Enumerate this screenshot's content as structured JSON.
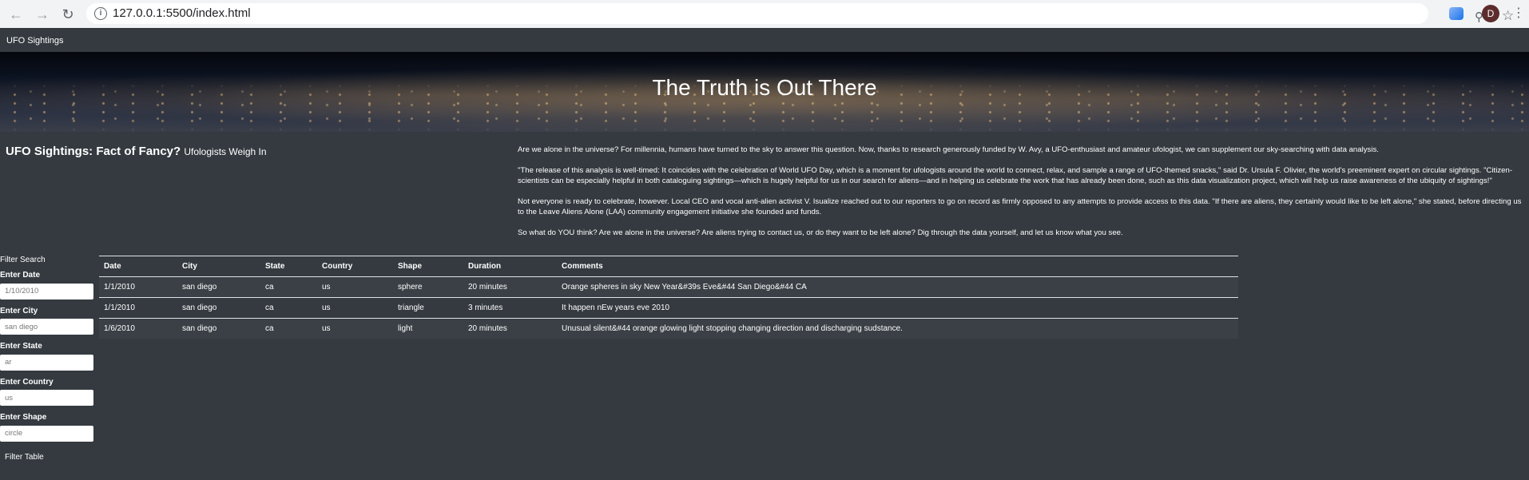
{
  "browser": {
    "url": "127.0.0.1:5500/index.html",
    "avatar_letter": "D",
    "icons": [
      "back-arrow-icon",
      "forward-arrow-icon",
      "reload-icon",
      "info-icon",
      "zoom-icon",
      "star-icon",
      "extension-icon",
      "menu-icon"
    ]
  },
  "navbar": {
    "brand": "UFO Sightings"
  },
  "hero": {
    "title": "The Truth is Out There"
  },
  "intro": {
    "title": "UFO Sightings: Fact of Fancy?",
    "subtitle": "Ufologists Weigh In",
    "paragraphs": [
      "Are we alone in the universe? For millennia, humans have turned to the sky to answer this question. Now, thanks to research generously funded by W. Avy, a UFO-enthusiast and amateur ufologist, we can supplement our sky-searching with data analysis.",
      "\"The release of this analysis is well-timed: It coincides with the celebration of World UFO Day, which is a moment for ufologists around the world to connect, relax, and sample a range of UFO-themed snacks,\" said Dr. Ursula F. Olivier, the world's preeminent expert on circular sightings. \"Citizen-scientists can be especially helpful in both cataloguing sightings—which is hugely helpful for us in our search for aliens—and in helping us celebrate the work that has already been done, such as this data visualization project, which will help us raise awareness of the ubiquity of sightings!\"",
      "Not everyone is ready to celebrate, however. Local CEO and vocal anti-alien activist V. Isualize reached out to our reporters to go on record as firmly opposed to any attempts to provide access to this data. \"If there are aliens, they certainly would like to be left alone,\" she stated, before directing us to the Leave Aliens Alone (LAA) community engagement initiative she founded and funds.",
      "So what do YOU think? Are we alone in the universe? Are aliens trying to contact us, or do they want to be left alone? Dig through the data yourself, and let us know what you see."
    ]
  },
  "filters": {
    "title": "Filter Search",
    "date_label": "Enter Date",
    "date_placeholder": "1/10/2010",
    "city_label": "Enter City",
    "city_placeholder": "san diego",
    "state_label": "Enter State",
    "state_placeholder": "ar",
    "country_label": "Enter Country",
    "country_placeholder": "us",
    "shape_label": "Enter Shape",
    "shape_placeholder": "circle",
    "button_label": "Filter Table"
  },
  "table": {
    "headers": [
      "Date",
      "City",
      "State",
      "Country",
      "Shape",
      "Duration",
      "Comments"
    ],
    "rows": [
      [
        "1/1/2010",
        "san diego",
        "ca",
        "us",
        "sphere",
        "20 minutes",
        "Orange spheres in sky New Year&#39s Eve&#44 San Diego&#44 CA"
      ],
      [
        "1/1/2010",
        "san diego",
        "ca",
        "us",
        "triangle",
        "3 minutes",
        "It happen nEw years eve 2010"
      ],
      [
        "1/6/2010",
        "san diego",
        "ca",
        "us",
        "light",
        "20 minutes",
        "Unusual silent&#44 orange glowing light stopping changing direction and discharging sudstance."
      ]
    ]
  }
}
